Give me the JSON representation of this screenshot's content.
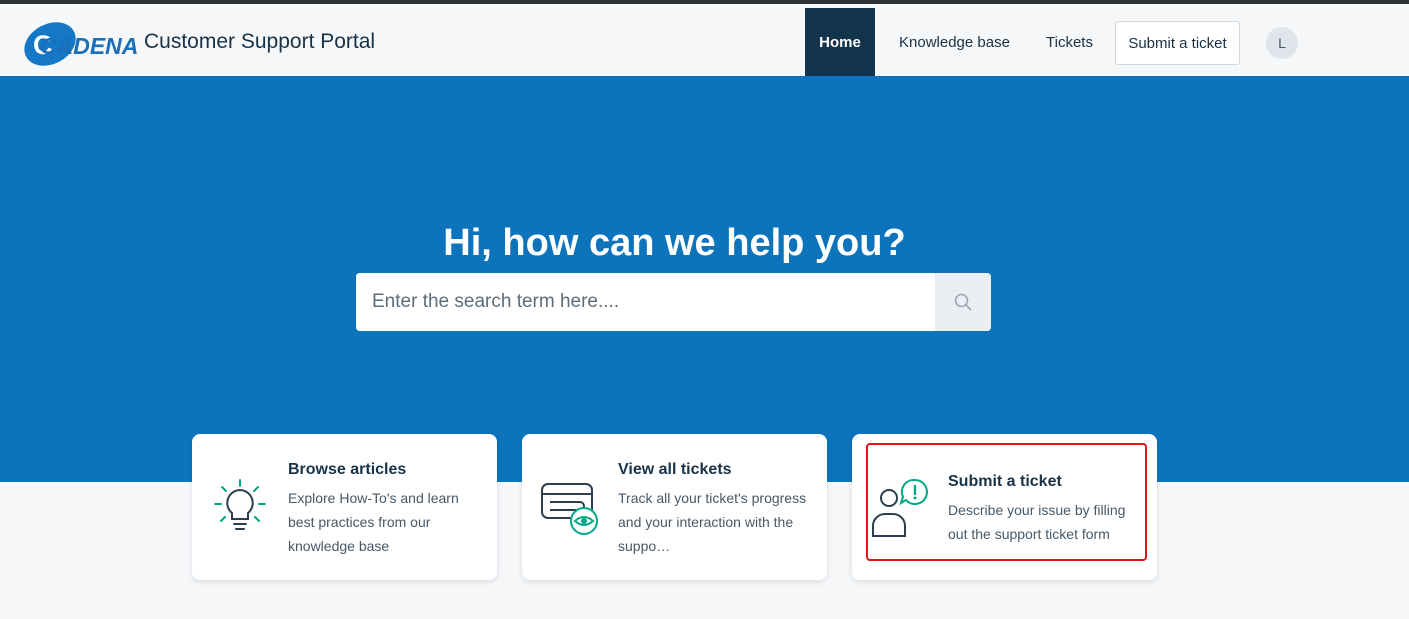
{
  "header": {
    "logo_text": "CADENA",
    "portal_title": "Customer Support Portal",
    "nav": {
      "home": "Home",
      "knowledge_base": "Knowledge base",
      "tickets": "Tickets",
      "submit_ticket": "Submit a ticket"
    },
    "avatar_initial": "L"
  },
  "hero": {
    "title": "Hi, how can we help you?",
    "search_placeholder": "Enter the search term here...."
  },
  "cards": [
    {
      "title": "Browse articles",
      "description": "Explore How-To's and learn best practices from our knowledge base",
      "icon": "lightbulb-icon"
    },
    {
      "title": "View all tickets",
      "description": "Track all your ticket's progress and your interaction with the suppo…",
      "icon": "ticket-eye-icon"
    },
    {
      "title": "Submit a ticket",
      "description": "Describe your issue by filling out the support ticket form",
      "icon": "person-alert-icon"
    }
  ],
  "colors": {
    "brand_blue": "#0d74bc",
    "nav_active": "#12344d",
    "icon_green": "#00a886",
    "highlight_red": "#e0161a"
  }
}
